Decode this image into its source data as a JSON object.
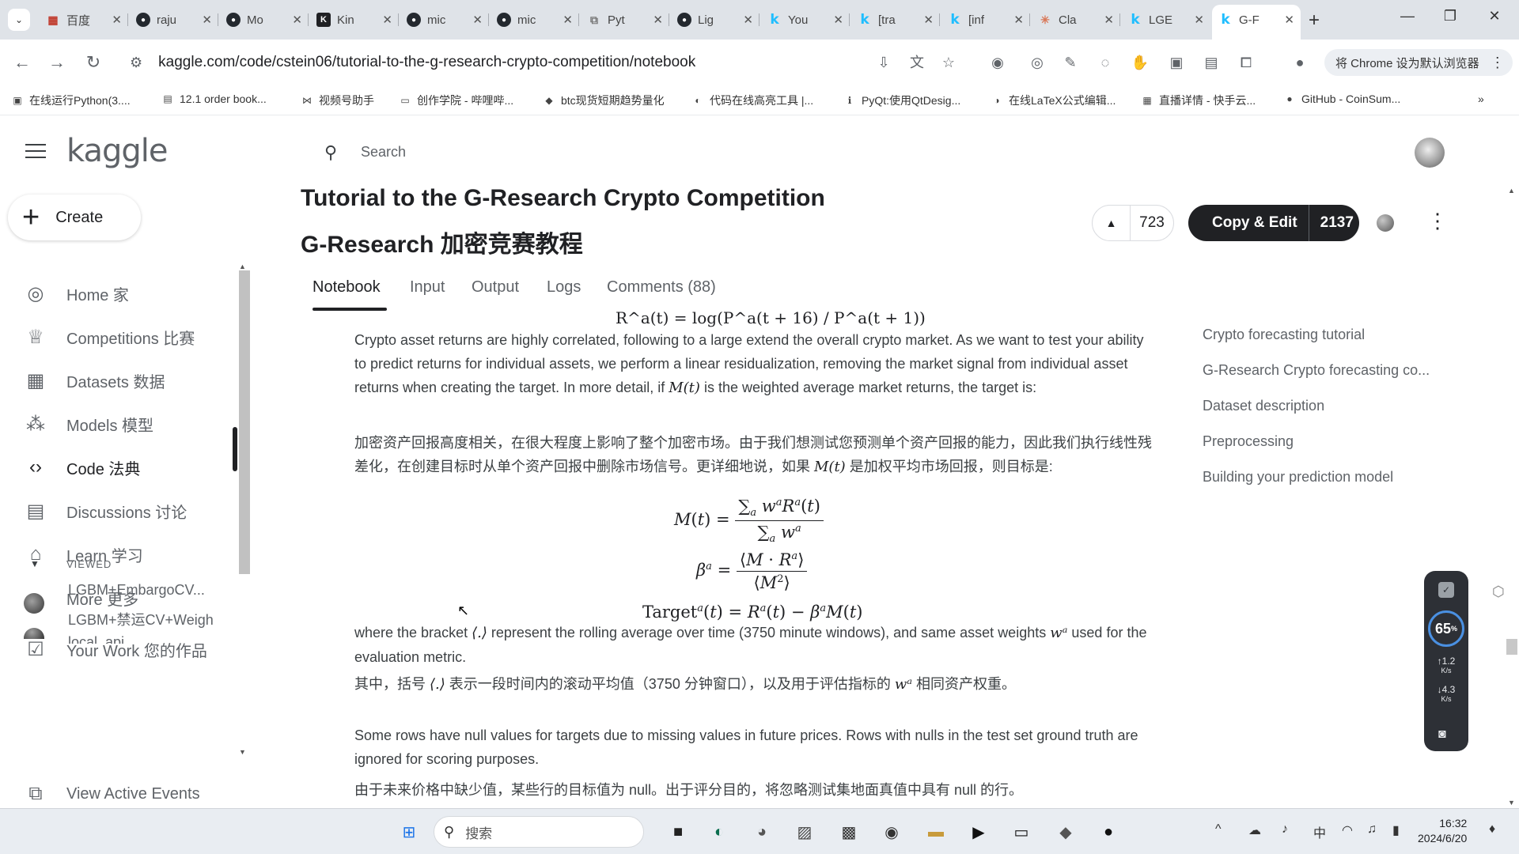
{
  "browser": {
    "tabs": [
      {
        "label": "百度",
        "icon": "baidu-icon"
      },
      {
        "label": "raju",
        "icon": "github-icon"
      },
      {
        "label": "Mo",
        "icon": "github-icon"
      },
      {
        "label": "Kin",
        "icon": "k-icon"
      },
      {
        "label": "mic",
        "icon": "github-icon"
      },
      {
        "label": "mic",
        "icon": "github-icon"
      },
      {
        "label": "Pyt",
        "icon": "pypi-icon"
      },
      {
        "label": "Lig",
        "icon": "github-icon"
      },
      {
        "label": "You",
        "icon": "kaggle-icon"
      },
      {
        "label": "[tra",
        "icon": "kaggle-icon"
      },
      {
        "label": "[inf",
        "icon": "kaggle-icon"
      },
      {
        "label": "Cla",
        "icon": "claude-icon"
      },
      {
        "label": "LGE",
        "icon": "kaggle-icon"
      },
      {
        "label": "G-F",
        "icon": "kaggle-icon"
      }
    ],
    "url": "kaggle.com/code/cstein06/tutorial-to-the-g-research-crypto-competition/notebook",
    "default_browser_label": "将 Chrome 设为默认浏览器",
    "bookmarks": [
      "在线运行Python(3....",
      "12.1 order book...",
      "视频号助手",
      "创作学院 - 哔哩哔...",
      "btc现货短期趋势量化",
      "代码在线高亮工具 |...",
      "PyQt:使用QtDesig...",
      "在线LaTeX公式编辑...",
      "直播详情 - 快手云...",
      "GitHub - CoinSum..."
    ]
  },
  "kaggle": {
    "logo": "kaggle",
    "create_label": "Create",
    "search_placeholder": "Search",
    "nav": [
      {
        "label": "Home 家",
        "icon": "compass-icon"
      },
      {
        "label": "Competitions 比赛",
        "icon": "trophy-icon"
      },
      {
        "label": "Datasets 数据",
        "icon": "table-icon"
      },
      {
        "label": "Models 模型",
        "icon": "models-icon"
      },
      {
        "label": "Code 法典",
        "icon": "code-icon"
      },
      {
        "label": "Discussions 讨论",
        "icon": "discussion-icon"
      },
      {
        "label": "Learn 学习",
        "icon": "graduation-cap-icon"
      },
      {
        "label": "More 更多",
        "icon": "chevron-down-icon"
      }
    ],
    "your_work_label": "Your Work 您的作品",
    "viewed_heading": "VIEWED",
    "viewed_items": [
      "LGBM+EmbargoCV...",
      "LGBM+禁运CV+Weigh",
      "local_api"
    ],
    "view_active_events": "View Active Events",
    "title_line1": "Tutorial to the G-Research Crypto Competition",
    "title_line2": "G-Research 加密竞赛教程",
    "upvotes": "723",
    "copy_edit_label": "Copy & Edit",
    "copy_edit_count": "2137",
    "notebook_tabs": [
      "Notebook",
      "Input",
      "Output",
      "Logs",
      "Comments (88)"
    ],
    "toc": [
      "Crypto forecasting tutorial",
      "G-Research Crypto forecasting co...",
      "Dataset description",
      "Preprocessing",
      "Building your prediction model"
    ]
  },
  "notebook": {
    "eq_top": "R^a(t) = log(P^a(t + 16) / P^a(t + 1))",
    "p1_before": "Crypto asset returns are highly correlated, following to a large extend the overall crypto market. As we want to test your ability to predict returns for individual assets, we perform a linear residualization, removing the market signal from individual asset returns when creating the target. In more detail, if ",
    "p1_math": "M(t)",
    "p1_after": " is the weighted average market returns, the target is:",
    "p2_before": "加密资产回报高度相关，在很大程度上影响了整个加密市场。由于我们想测试您预测单个资产回报的能力，因此我们执行线性残差化，在创建目标时从单个资产回报中删除市场信号。更详细地说，如果 ",
    "p2_math": "M(t)",
    "p2_after": " 是加权平均市场回报，则目标是:",
    "p3_before": "where the bracket ",
    "p3_math1": "⟨.⟩",
    "p3_mid": " represent the rolling average over time (3750 minute windows), and same asset weights ",
    "p3_math2": "wᵃ",
    "p3_after": " used for the evaluation metric.",
    "p4_before": "其中，括号 ",
    "p4_math1": "⟨.⟩",
    "p4_mid": " 表示一段时间内的滚动平均值（3750 分钟窗口），以及用于评估指标的 ",
    "p4_math2": "wᵃ",
    "p4_after": " 相同资产权重。",
    "p5": "Some rows have null values for targets due to missing values in future prices. Rows with nulls in the test set ground truth are ignored for scoring purposes.",
    "p6": "由于未来价格中缺少值，某些行的目标值为 null。出于评分目的，将忽略测试集地面真值中具有 null 的行。"
  },
  "widget": {
    "percent": "65",
    "percent_unit": "%",
    "upload": "1.2",
    "download": "4.3",
    "speed_unit": "K/s"
  },
  "taskbar": {
    "search_placeholder": "搜索",
    "ime": "中",
    "time": "16:32",
    "date": "2024/6/20"
  }
}
